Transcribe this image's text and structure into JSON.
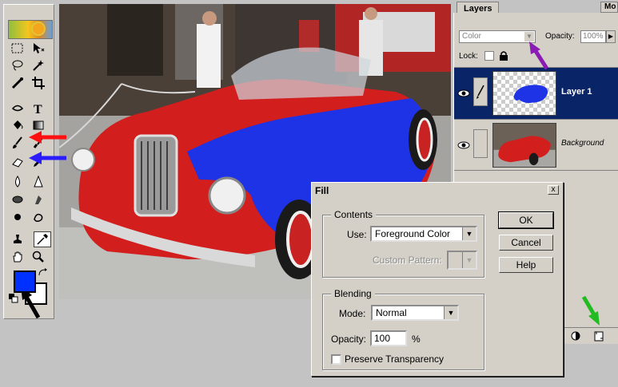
{
  "colors": {
    "foreground": "#0030ff",
    "background": "#ffffff",
    "selected_layer": "#0a2468",
    "annotation_red": "#ff1010",
    "annotation_blue": "#2a1cff",
    "annotation_black": "#000000",
    "annotation_purple": "#8a1cb3",
    "annotation_green": "#22bb22"
  },
  "toolbox": {
    "tools": [
      "marquee-icon",
      "move-icon",
      "lasso-icon",
      "magic-wand-icon",
      "healing-brush-icon",
      "crop-icon",
      "pen-icon",
      "type-icon",
      "paint-bucket-icon",
      "gradient-icon",
      "brush-icon",
      "pencil-icon",
      "eraser-icon",
      "history-brush-icon",
      "blur-icon",
      "sharpen-icon",
      "dodge-icon",
      "burn-icon",
      "sponge-icon",
      "smudge-icon",
      "clone-stamp-icon",
      "eyedropper-icon",
      "hand-icon",
      "zoom-icon"
    ]
  },
  "layers": {
    "tab": "Layers",
    "more": "Mo",
    "blend_mode": "Color",
    "opacity_label": "Opacity:",
    "opacity_value": "100%",
    "lock_label": "Lock:",
    "items": [
      {
        "name": "Layer 1",
        "selected": true
      },
      {
        "name": "Background",
        "selected": false
      }
    ]
  },
  "fill_dialog": {
    "title": "Fill",
    "close": "x",
    "contents_label": "Contents",
    "use_label": "Use:",
    "use_value": "Foreground Color",
    "custom_pattern_label": "Custom Pattern:",
    "blending_label": "Blending",
    "mode_label": "Mode:",
    "mode_value": "Normal",
    "opacity_label": "Opacity:",
    "opacity_value": "100",
    "opacity_unit": "%",
    "preserve_label": "Preserve Transparency",
    "ok": "OK",
    "cancel": "Cancel",
    "help": "Help"
  }
}
